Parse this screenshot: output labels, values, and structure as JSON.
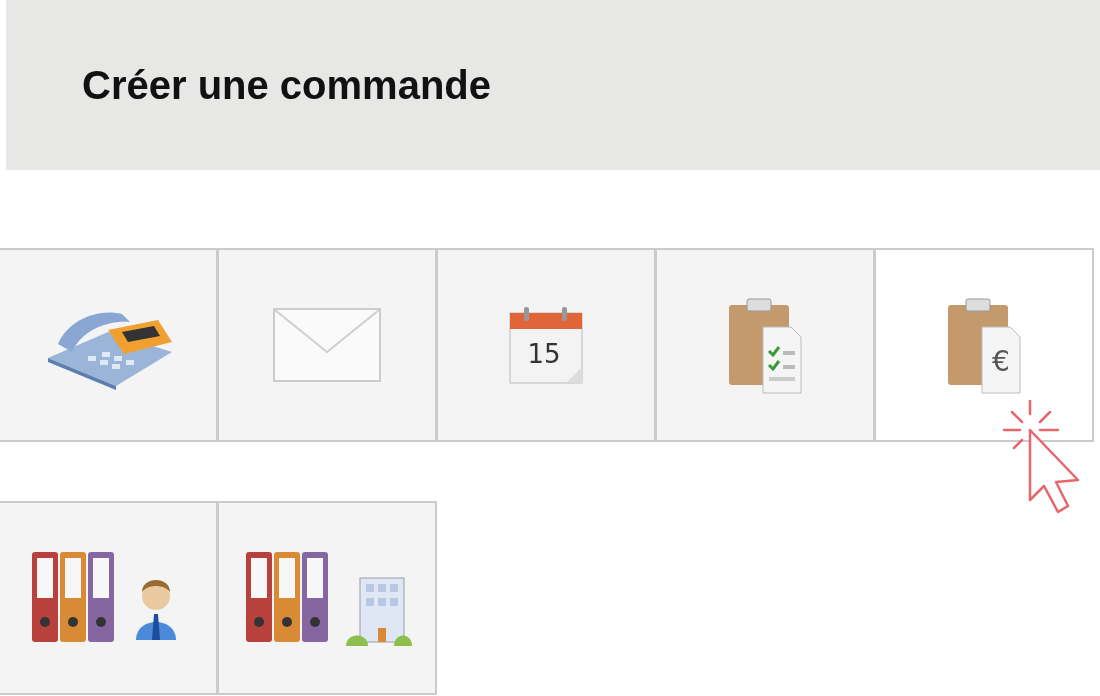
{
  "header": {
    "title": "Créer une commande"
  },
  "tiles": [
    {
      "kind": "phone",
      "selected": false
    },
    {
      "kind": "envelope",
      "selected": false
    },
    {
      "kind": "calendar",
      "selected": false,
      "text": "15"
    },
    {
      "kind": "clipboard-checklist",
      "selected": false
    },
    {
      "kind": "clipboard-euro",
      "selected": true,
      "text": "€"
    },
    {
      "kind": "binders-person",
      "selected": false
    },
    {
      "kind": "binders-building",
      "selected": false
    }
  ]
}
